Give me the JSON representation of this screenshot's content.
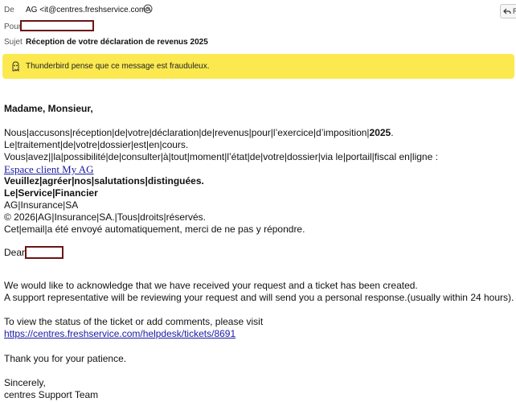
{
  "header": {
    "from_label": "De",
    "from_value": "AG <it@centres.freshservice.com>",
    "to_label": "Pour",
    "subject_label": "Sujet",
    "subject_value": "Réception de votre déclaration de revenus 2025",
    "reply_label": "R"
  },
  "banner": {
    "text": "Thunderbird pense que ce message est frauduleux.",
    "icon": "scam-warning-icon",
    "color": "#fce94f"
  },
  "body": {
    "greeting": "Madame, Monsieur,",
    "fr_line1_a": "Nous|accusons|réception|de|votre|déclaration|de|revenus|pour|l’exercice|d’imposition|",
    "fr_line1_b": "2025",
    "fr_line1_c": ".",
    "fr_line2": "Le|traitement|de|votre|dossier|est|en|cours.",
    "fr_line3": "Vous|avez||la|possibilité|de|consulter|à|tout|moment|l’état|de|votre|dossier|via le|portail|fiscal en|ligne :",
    "fr_link": "Espace client My AG",
    "fr_line4": "Veuillez|agréer|nos|salutations|distinguées.",
    "fr_line5": "Le|Service|Financier",
    "fr_line6": "AG|Insurance|SA",
    "fr_line7": "© 2026|AG|Insurance|SA.|Tous|droits|réservés.",
    "fr_line8": "Cet|email|a été envoyé automatiquement, merci de ne pas y répondre.",
    "dear": "Dear",
    "en_line1": "We would like to acknowledge that we have received your request and a ticket has been created.",
    "en_line2": "A support representative will be reviewing your request and will send you a personal response.(usually within 24 hours).",
    "en_line3": "To view the status of the ticket or add comments, please visit",
    "en_link": "https://centres.freshservice.com/helpdesk/tickets/8691",
    "en_line4": "Thank you for your patience.",
    "en_line5": "Sincerely,",
    "en_line6": "centres Support Team"
  }
}
